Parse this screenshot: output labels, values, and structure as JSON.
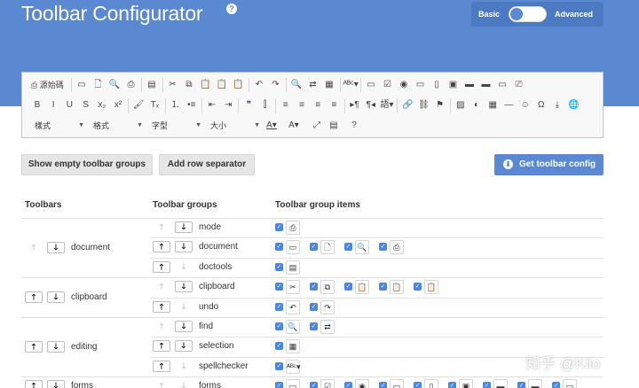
{
  "header": {
    "title": "Toolbar Configurator",
    "help_icon": "?",
    "mode_basic": "Basic",
    "mode_advanced": "Advanced"
  },
  "editor_toolbar": {
    "row1": [
      {
        "icon": "source-icon",
        "glyph": "⎙ 源始碼",
        "text": true
      },
      {
        "icon": "save-icon",
        "glyph": "▭"
      },
      {
        "icon": "new-page-icon",
        "glyph": "🗋"
      },
      {
        "icon": "preview-icon",
        "glyph": "🔍"
      },
      {
        "icon": "print-icon",
        "glyph": "⎙"
      },
      {
        "icon": "templates-icon",
        "glyph": "▤"
      },
      {
        "icon": "cut-icon",
        "glyph": "✂"
      },
      {
        "icon": "copy-icon",
        "glyph": "⧉"
      },
      {
        "icon": "paste-icon",
        "glyph": "📋"
      },
      {
        "icon": "paste-text-icon",
        "glyph": "📋"
      },
      {
        "icon": "paste-word-icon",
        "glyph": "📋"
      },
      {
        "icon": "undo-icon",
        "glyph": "↶"
      },
      {
        "icon": "redo-icon",
        "glyph": "↷"
      },
      {
        "icon": "find-icon",
        "glyph": "🔍"
      },
      {
        "icon": "replace-icon",
        "glyph": "⇄"
      },
      {
        "icon": "select-all-icon",
        "glyph": "▦"
      },
      {
        "icon": "spellcheck-icon",
        "glyph": "ᴬᴮᶜ▾"
      },
      {
        "icon": "form-icon",
        "glyph": "▭"
      },
      {
        "icon": "checkbox-icon",
        "glyph": "☑"
      },
      {
        "icon": "radio-icon",
        "glyph": "◉"
      },
      {
        "icon": "textfield-icon",
        "glyph": "▭"
      },
      {
        "icon": "textarea-icon",
        "glyph": "▯"
      },
      {
        "icon": "select-icon",
        "glyph": "▣"
      },
      {
        "icon": "button-icon",
        "glyph": "▬"
      },
      {
        "icon": "image-button-icon",
        "glyph": "▬"
      },
      {
        "icon": "hidden-field-icon",
        "glyph": "▭"
      },
      {
        "icon": "removeformat-icon",
        "glyph": "⎚"
      }
    ],
    "row2": [
      {
        "icon": "bold-icon",
        "glyph": "B"
      },
      {
        "icon": "italic-icon",
        "glyph": "I"
      },
      {
        "icon": "underline-icon",
        "glyph": "U"
      },
      {
        "icon": "strike-icon",
        "glyph": "S"
      },
      {
        "icon": "subscript-icon",
        "glyph": "x₂"
      },
      {
        "icon": "superscript-icon",
        "glyph": "x²"
      },
      {
        "icon": "copy-format-icon",
        "glyph": "🖌"
      },
      {
        "icon": "remove-format-icon",
        "glyph": "Tₓ"
      },
      {
        "icon": "numbered-list-icon",
        "glyph": "⒈"
      },
      {
        "icon": "bulleted-list-icon",
        "glyph": "•≡"
      },
      {
        "icon": "outdent-icon",
        "glyph": "⇤"
      },
      {
        "icon": "indent-icon",
        "glyph": "⇥"
      },
      {
        "icon": "blockquote-icon",
        "glyph": "❞"
      },
      {
        "icon": "div-icon",
        "glyph": "⫿"
      },
      {
        "icon": "align-left-icon",
        "glyph": "≡"
      },
      {
        "icon": "align-center-icon",
        "glyph": "≡"
      },
      {
        "icon": "align-right-icon",
        "glyph": "≡"
      },
      {
        "icon": "justify-icon",
        "glyph": "≡"
      },
      {
        "icon": "ltr-icon",
        "glyph": "▸¶"
      },
      {
        "icon": "rtl-icon",
        "glyph": "¶◂"
      },
      {
        "icon": "language-icon",
        "glyph": "語▾"
      },
      {
        "icon": "link-icon",
        "glyph": "🔗"
      },
      {
        "icon": "unlink-icon",
        "glyph": "⛓"
      },
      {
        "icon": "anchor-icon",
        "glyph": "⚑"
      },
      {
        "icon": "image-icon",
        "glyph": "▨"
      },
      {
        "icon": "flash-icon",
        "glyph": "◐"
      },
      {
        "icon": "table-icon",
        "glyph": "▦"
      },
      {
        "icon": "horizontal-rule-icon",
        "glyph": "―"
      },
      {
        "icon": "smiley-icon",
        "glyph": "☺"
      },
      {
        "icon": "special-char-icon",
        "glyph": "Ω"
      },
      {
        "icon": "page-break-icon",
        "glyph": "⤓"
      },
      {
        "icon": "iframe-icon",
        "glyph": "🌐"
      }
    ],
    "row3_combos": [
      "樣式",
      "格式",
      "字型",
      "大小"
    ],
    "row3_buttons": [
      {
        "icon": "text-color-icon",
        "glyph": "A▾"
      },
      {
        "icon": "bg-color-icon",
        "glyph": "A▾"
      },
      {
        "icon": "maximize-icon",
        "glyph": "⤢"
      },
      {
        "icon": "show-blocks-icon",
        "glyph": "▤"
      },
      {
        "icon": "about-icon",
        "glyph": "?"
      }
    ]
  },
  "actions": {
    "show_empty": "Show empty toolbar groups",
    "add_separator": "Add row separator",
    "get_config": "Get toolbar config"
  },
  "table": {
    "headers": [
      "Toolbars",
      "Toolbar groups",
      "Toolbar group items"
    ],
    "toolbars": [
      {
        "name": "document",
        "up_enabled": false,
        "down_enabled": true,
        "groups": [
          {
            "name": "mode",
            "up_enabled": false,
            "down_enabled": true,
            "items": [
              "source-icon"
            ]
          },
          {
            "name": "document",
            "up_enabled": true,
            "down_enabled": true,
            "items": [
              "save-icon",
              "new-page-icon",
              "preview-icon",
              "print-icon"
            ]
          },
          {
            "name": "doctools",
            "up_enabled": true,
            "down_enabled": false,
            "items": [
              "templates-icon"
            ]
          }
        ]
      },
      {
        "name": "clipboard",
        "up_enabled": true,
        "down_enabled": true,
        "groups": [
          {
            "name": "clipboard",
            "up_enabled": false,
            "down_enabled": true,
            "items": [
              "cut-icon",
              "copy-icon",
              "paste-icon",
              "paste-text-icon",
              "paste-word-icon"
            ]
          },
          {
            "name": "undo",
            "up_enabled": true,
            "down_enabled": false,
            "items": [
              "undo-icon",
              "redo-icon"
            ]
          }
        ]
      },
      {
        "name": "editing",
        "up_enabled": true,
        "down_enabled": true,
        "groups": [
          {
            "name": "find",
            "up_enabled": false,
            "down_enabled": true,
            "items": [
              "find-icon",
              "replace-icon"
            ]
          },
          {
            "name": "selection",
            "up_enabled": true,
            "down_enabled": true,
            "items": [
              "select-all-icon"
            ]
          },
          {
            "name": "spellchecker",
            "up_enabled": true,
            "down_enabled": false,
            "items": [
              "spellcheck-icon"
            ]
          }
        ]
      },
      {
        "name": "forms",
        "up_enabled": true,
        "down_enabled": true,
        "groups": [
          {
            "name": "forms",
            "up_enabled": false,
            "down_enabled": false,
            "items": [
              "form-icon",
              "checkbox-icon",
              "radio-icon",
              "textfield-icon",
              "textarea-icon",
              "select-icon",
              "button-icon",
              "image-button-icon",
              "hidden-field-icon"
            ]
          }
        ]
      }
    ]
  },
  "watermark": "知乎 @Kilo"
}
